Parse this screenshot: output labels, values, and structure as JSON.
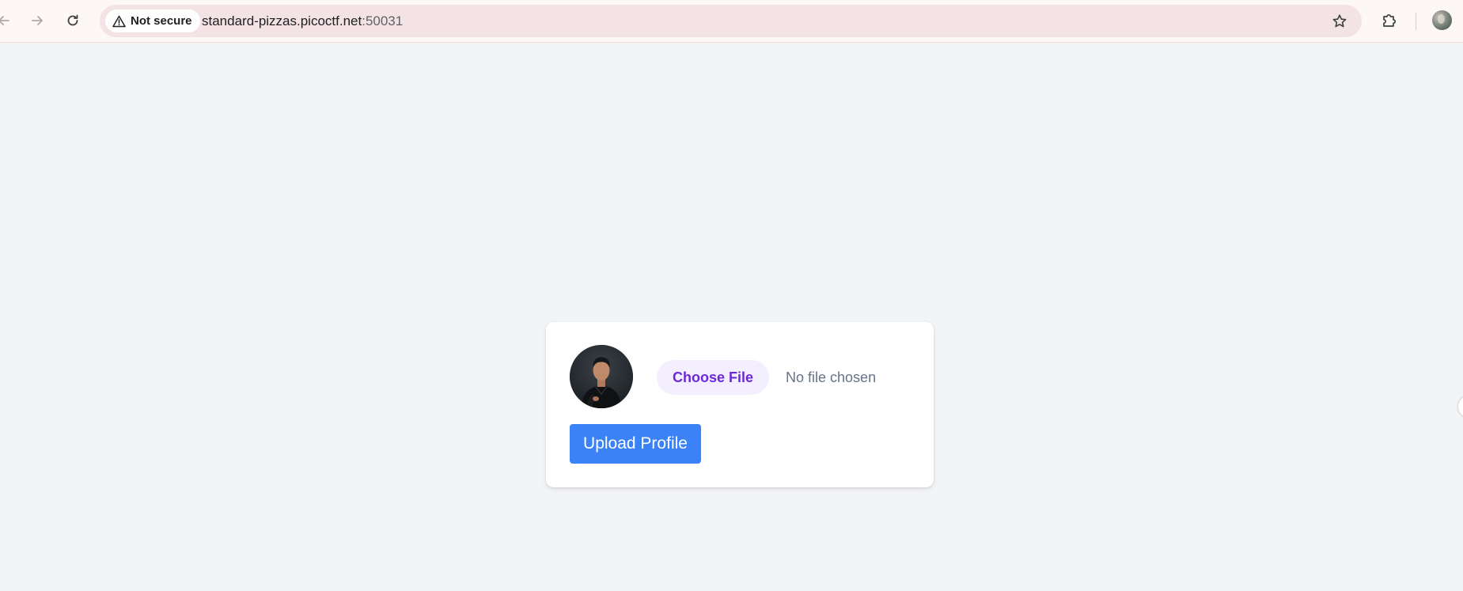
{
  "browser": {
    "security_label": "Not secure",
    "url_host": "standard-pizzas.picoctf.net",
    "url_port": ":50031",
    "icons": {
      "back": "arrow-left-icon",
      "forward": "arrow-right-icon",
      "reload": "reload-icon",
      "security": "warning-triangle-icon",
      "bookmark": "star-icon",
      "extensions": "puzzle-icon",
      "profile": "profile-avatar"
    }
  },
  "profile_form": {
    "avatar_icon": "profile-photo",
    "choose_file_label": "Choose File",
    "file_status": "No file chosen",
    "upload_label": "Upload Profile"
  },
  "colors": {
    "page_background": "#f3f4f6",
    "choose_file_bg": "#f3efff",
    "choose_file_text": "#6d28d9",
    "upload_button": "#3b82f6",
    "omnibox_bg": "#f4e3e4"
  }
}
